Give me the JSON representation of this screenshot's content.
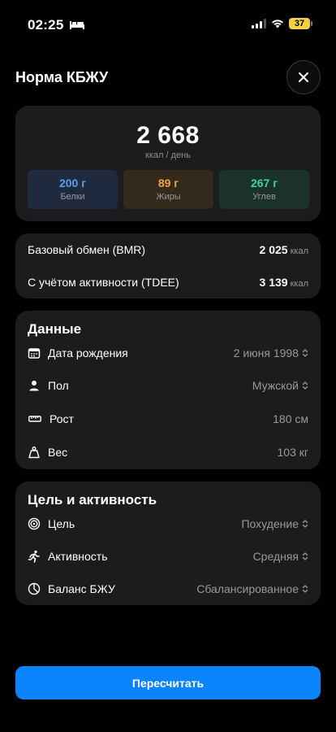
{
  "status_bar": {
    "time": "02:25",
    "battery": "37"
  },
  "header": {
    "title": "Норма КБЖУ"
  },
  "summary": {
    "calories": "2 668",
    "unit": "ккал / день",
    "macros": [
      {
        "value": "200 г",
        "label": "Белки",
        "color": "#5b9cf5"
      },
      {
        "value": "89 г",
        "label": "Жиры",
        "color": "#f0a545"
      },
      {
        "value": "267 г",
        "label": "Углев",
        "color": "#3fd49a"
      }
    ]
  },
  "energy": {
    "bmr": {
      "label": "Базовый обмен (BMR)",
      "value": "2 025",
      "unit": "ккал"
    },
    "tdee": {
      "label": "С учётом активности (TDEE)",
      "value": "3 139",
      "unit": "ккал"
    }
  },
  "data_section": {
    "title": "Данные",
    "rows": [
      {
        "icon": "calendar-icon",
        "label": "Дата рождения",
        "value": "2 июня 1998"
      },
      {
        "icon": "person-icon",
        "label": "Пол",
        "value": "Мужской"
      },
      {
        "icon": "ruler-icon",
        "label": "Рост",
        "value": "180 см"
      },
      {
        "icon": "weight-icon",
        "label": "Вес",
        "value": "103 кг"
      }
    ]
  },
  "goal_section": {
    "title": "Цель и активность",
    "rows": [
      {
        "icon": "target-icon",
        "label": "Цель",
        "value": "Похудение"
      },
      {
        "icon": "running-icon",
        "label": "Активность",
        "value": "Средняя"
      },
      {
        "icon": "pie-chart-icon",
        "label": "Баланс БЖУ",
        "value": "Сбалансированное"
      }
    ]
  },
  "actions": {
    "recalculate": "Пересчитать"
  },
  "colors": {
    "accent": "#0a84ff",
    "card": "#1c1c1e",
    "background": "#000000"
  }
}
